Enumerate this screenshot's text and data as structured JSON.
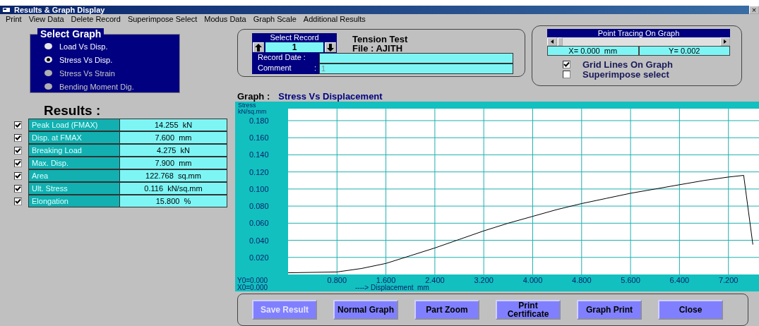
{
  "window": {
    "title": "Results & Graph Display",
    "close": "×"
  },
  "menu": [
    "Print",
    "View Data",
    "Delete Record",
    "Superimpose Select",
    "Modus Data",
    "Graph Scale",
    "Additional Results"
  ],
  "select_graph": {
    "title": "Select Graph",
    "options": [
      {
        "label": "Load Vs Disp.",
        "selected": false,
        "disabled": false
      },
      {
        "label": "Stress Vs Disp.",
        "selected": true,
        "disabled": false
      },
      {
        "label": "Stress Vs Strain",
        "selected": false,
        "disabled": true
      },
      {
        "label": "Bending Moment Dig.",
        "selected": false,
        "disabled": true
      }
    ]
  },
  "results": {
    "title": "Results :",
    "rows": [
      {
        "checked": true,
        "label": "Peak Load (FMAX)",
        "value": "14.255  kN"
      },
      {
        "checked": true,
        "label": "Disp. at FMAX",
        "value": "7.600  mm"
      },
      {
        "checked": true,
        "label": "Breaking Load",
        "value": "4.275  kN"
      },
      {
        "checked": true,
        "label": "Max. Disp.",
        "value": "7.900  mm"
      },
      {
        "checked": true,
        "label": "Area",
        "value": "122.768  sq.mm"
      },
      {
        "checked": true,
        "label": "Ult. Stress",
        "value": "0.116  kN/sq.mm"
      },
      {
        "checked": true,
        "label": "Elongation",
        "value": "15.800  %"
      }
    ]
  },
  "record": {
    "title": "Select Record",
    "value": "1",
    "test": "Tension Test",
    "file": "File : AJITH",
    "date_label": "Record Date :",
    "comment_label": "Comment",
    "comment_sep": ":",
    "comment": "1"
  },
  "tracing": {
    "title": "Point Tracing On Graph",
    "x": "X= 0.000  mm",
    "y": "Y= 0.002",
    "options": [
      {
        "label": "Grid Lines On Graph",
        "checked": true
      },
      {
        "label": "Superimpose select",
        "checked": false
      }
    ]
  },
  "graph": {
    "title_label": "Graph :",
    "title": "Stress Vs Displacement",
    "y0": "Y0=0.000",
    "x0": "X0=0.000",
    "chart_data": {
      "type": "line",
      "ylabel": "Stress kN/sq.mm",
      "xlabel": "----> Displacement  mm",
      "grid": true,
      "xlim": [
        0,
        7.7
      ],
      "ylim": [
        0,
        0.194
      ],
      "xticks": [
        {
          "value": 0.8,
          "label": "0.800"
        },
        {
          "value": 1.6,
          "label": "1.600"
        },
        {
          "value": 2.4,
          "label": "2.400"
        },
        {
          "value": 3.2,
          "label": "3.200"
        },
        {
          "value": 4.0,
          "label": "4.000"
        },
        {
          "value": 4.8,
          "label": "4.800"
        },
        {
          "value": 5.6,
          "label": "5.600"
        },
        {
          "value": 6.4,
          "label": "6.400"
        },
        {
          "value": 7.2,
          "label": "7.200"
        }
      ],
      "yticks": [
        {
          "value": 0.02,
          "label": "0.020"
        },
        {
          "value": 0.04,
          "label": "0.040"
        },
        {
          "value": 0.06,
          "label": "0.060"
        },
        {
          "value": 0.08,
          "label": "0.080"
        },
        {
          "value": 0.1,
          "label": "0.100"
        },
        {
          "value": 0.12,
          "label": "0.120"
        },
        {
          "value": 0.14,
          "label": "0.140"
        },
        {
          "value": 0.16,
          "label": "0.160"
        },
        {
          "value": 0.18,
          "label": "0.180"
        }
      ],
      "x": [
        0,
        0.8,
        1.2,
        1.6,
        2.0,
        2.4,
        2.8,
        3.2,
        3.6,
        4.0,
        4.4,
        4.8,
        5.2,
        5.6,
        6.0,
        6.4,
        6.8,
        7.2,
        7.45,
        7.6
      ],
      "series": [
        {
          "color": "#000000",
          "values": [
            0.002,
            0.003,
            0.007,
            0.013,
            0.022,
            0.031,
            0.041,
            0.051,
            0.06,
            0.068,
            0.076,
            0.083,
            0.089,
            0.095,
            0.1,
            0.105,
            0.11,
            0.114,
            0.116,
            0.035
          ]
        }
      ]
    }
  },
  "buttons": [
    {
      "label": "Save Result",
      "disabled": true
    },
    {
      "label": "Normal Graph",
      "disabled": false
    },
    {
      "label": "Part Zoom",
      "disabled": false
    },
    {
      "label": "Print Certificate",
      "disabled": false
    },
    {
      "label": "Graph Print",
      "disabled": false
    },
    {
      "label": "Close",
      "disabled": false
    }
  ]
}
